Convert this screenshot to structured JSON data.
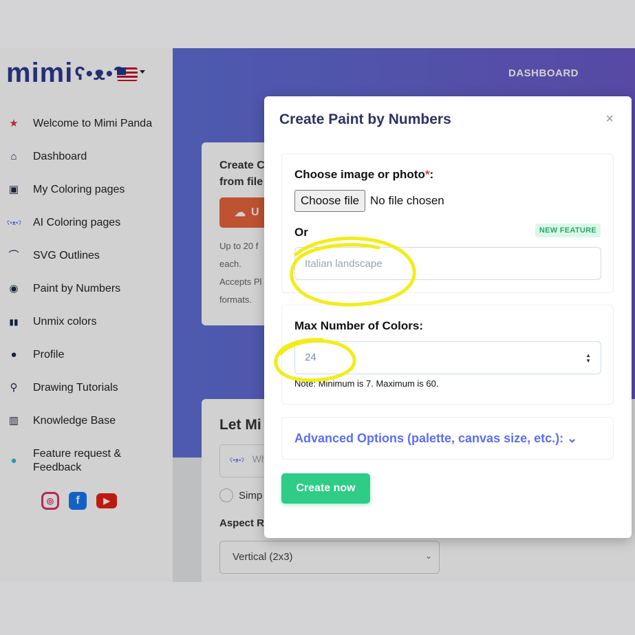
{
  "sidebar": {
    "brand": "mimi",
    "items": [
      {
        "label": "Welcome to Mimi Panda",
        "icon": "star-icon",
        "glyph": "★",
        "color": "#e0334f"
      },
      {
        "label": "Dashboard",
        "icon": "home-icon",
        "glyph": "⌂",
        "color": "#1f2a44"
      },
      {
        "label": "My Coloring pages",
        "icon": "image-icon",
        "glyph": "▣",
        "color": "#1f2a44"
      },
      {
        "label": "AI Coloring pages",
        "icon": "panda-icon",
        "glyph": "ʕ•ᴥ•ʔ",
        "color": "#5b6ff0"
      },
      {
        "label": "SVG Outlines",
        "icon": "vector-icon",
        "glyph": "⌒",
        "color": "#1f2a44"
      },
      {
        "label": "Paint by Numbers",
        "icon": "palette-icon",
        "glyph": "◉",
        "color": "#1f2a44"
      },
      {
        "label": "Unmix colors",
        "icon": "paint-tubes-icon",
        "glyph": "▮▮",
        "color": "#1f2a44"
      },
      {
        "label": "Profile",
        "icon": "user-icon",
        "glyph": "●",
        "color": "#1f2a44"
      },
      {
        "label": "Drawing Tutorials",
        "icon": "compass-icon",
        "glyph": "⚲",
        "color": "#1f2a44"
      },
      {
        "label": "Knowledge Base",
        "icon": "books-icon",
        "glyph": "▥",
        "color": "#1f2a44"
      },
      {
        "label": "Feature request & Feedback",
        "icon": "lightbulb-icon",
        "glyph": "●",
        "color": "#35b8e0"
      }
    ]
  },
  "header": {
    "dashboard_link": "DASHBOARD"
  },
  "background": {
    "card1_title": "Create C from file",
    "upload_label": "U",
    "card1_text_lines": [
      "Up to 20 f",
      "each.",
      "Accepts Pl",
      "formats."
    ],
    "card2_title": "Let Mi",
    "prompt_placeholder": "Wh",
    "radio_label": "Simp",
    "aspect_label": "Aspect Ra",
    "aspect_value": "Vertical (2x3)"
  },
  "modal": {
    "title": "Create Paint by Numbers",
    "close": "×",
    "image_label": "Choose image or photo",
    "required_mark": "*",
    "image_label_suffix": ":",
    "file_button": "Choose file",
    "file_status": "No file chosen",
    "or_label": "Or",
    "new_badge": "NEW FEATURE",
    "prompt_placeholder": "Italian landscape",
    "max_colors_label": "Max Number of Colors:",
    "max_colors_value": "24",
    "note": "Note: Minimum is 7. Maximum is 60.",
    "advanced": "Advanced Options (palette, canvas size, etc.):",
    "advanced_chevron": "⌄",
    "create_button": "Create now"
  },
  "colors": {
    "accent": "#5b6ff0",
    "primary_green": "#2ecc87",
    "brand_navy": "#2f3a8f",
    "highlight_yellow": "#f2ec1c"
  }
}
